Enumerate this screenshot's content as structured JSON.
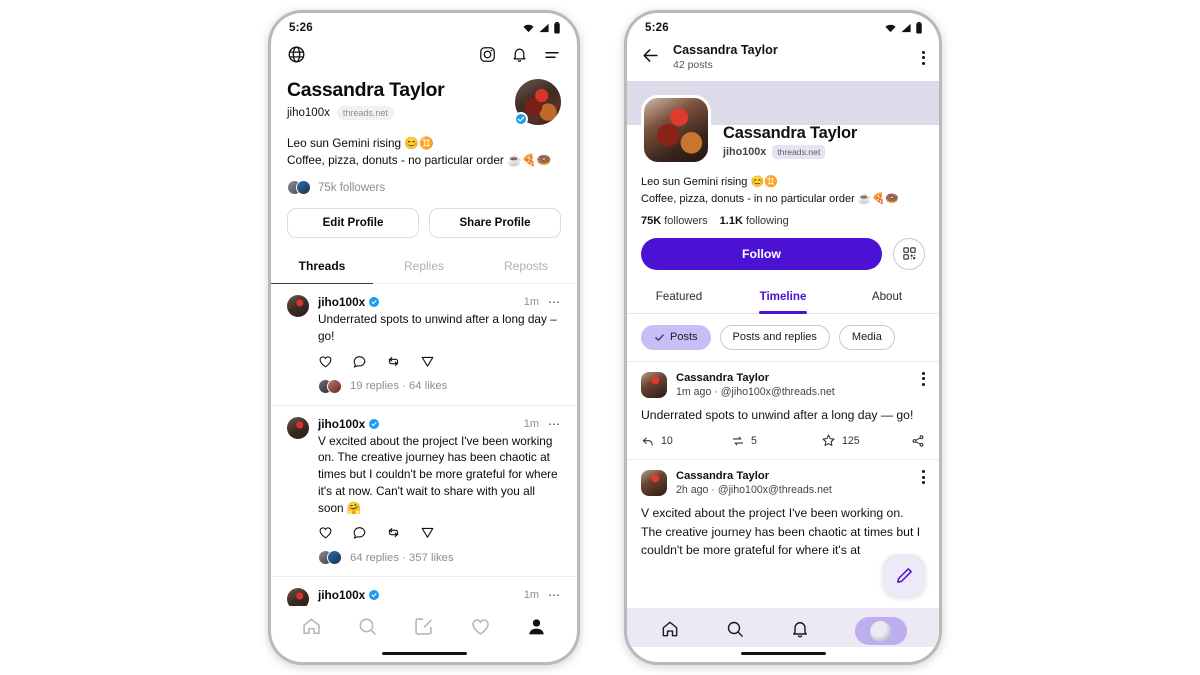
{
  "left_phone": {
    "status": {
      "time": "5:26",
      "wifi": "wifi-icon",
      "signal": "signal-icon",
      "battery": "battery-icon"
    },
    "topbar": {
      "globe": "globe-icon",
      "instagram": "instagram-icon",
      "bell": "bell-icon",
      "menu": "menu-icon"
    },
    "profile": {
      "name": "Cassandra Taylor",
      "handle": "jiho100x",
      "domain": "threads.net",
      "bio_line1": "Leo sun Gemini rising 😊♊",
      "bio_line2": "Coffee, pizza, donuts - no particular order ☕🍕🍩",
      "followers": "75k followers",
      "verified": true
    },
    "buttons": {
      "edit": "Edit Profile",
      "share": "Share Profile"
    },
    "tabs": [
      {
        "label": "Threads",
        "active": true
      },
      {
        "label": "Replies",
        "active": false
      },
      {
        "label": "Reposts",
        "active": false
      }
    ],
    "posts": [
      {
        "name": "jiho100x",
        "time": "1m",
        "text": "Underrated spots to unwind after a long day – go!",
        "stats": "19 replies · 64 likes",
        "actions": [
          "heart-icon",
          "comment-icon",
          "repost-icon",
          "send-icon"
        ]
      },
      {
        "name": "jiho100x",
        "time": "1m",
        "text": "V excited about the project I've been working on. The creative journey has been chaotic at times but I couldn't be more grateful for where it's at now. Can't wait to share with you all soon 🤗",
        "stats": "64 replies · 357 likes",
        "actions": [
          "heart-icon",
          "comment-icon",
          "repost-icon",
          "send-icon"
        ]
      },
      {
        "name": "jiho100x",
        "time": "1m",
        "text": "",
        "stats": "",
        "actions": []
      }
    ],
    "bottom_nav": [
      "home-icon",
      "search-icon",
      "compose-icon",
      "heart-icon",
      "profile-icon"
    ]
  },
  "right_phone": {
    "status": {
      "time": "5:26",
      "wifi": "wifi-icon",
      "signal": "signal-icon",
      "battery": "battery-icon"
    },
    "topbar": {
      "back": "back-arrow-icon",
      "title": "Cassandra Taylor",
      "subtitle": "42 posts",
      "kebab": "more-vertical-icon"
    },
    "profile": {
      "name": "Cassandra Taylor",
      "handle": "jiho100x",
      "domain": "threads.net",
      "bio_line1": "Leo sun Gemini rising 😊♊",
      "bio_line2": "Coffee, pizza, donuts - in no particular order ☕🍕🍩",
      "followers_count": "75K",
      "followers_label": "followers",
      "following_count": "1.1K",
      "following_label": "following"
    },
    "follow_button": "Follow",
    "qr_button": "qr-code-icon",
    "tabs": [
      {
        "label": "Featured",
        "active": false
      },
      {
        "label": "Timeline",
        "active": true
      },
      {
        "label": "About",
        "active": false
      }
    ],
    "chips": [
      {
        "label": "Posts",
        "active": true
      },
      {
        "label": "Posts and replies",
        "active": false
      },
      {
        "label": "Media",
        "active": false
      }
    ],
    "posts": [
      {
        "name": "Cassandra Taylor",
        "meta": "1m ago · @jiho100x@threads.net",
        "text": "Underrated spots to unwind after a long day — go!",
        "reply_count": "10",
        "repost_count": "5",
        "star_count": "125",
        "share": "share-icon"
      },
      {
        "name": "Cassandra Taylor",
        "meta": "2h ago · @jiho100x@threads.net",
        "text": "V excited about the project I've been working on. The creative journey has been chaotic at times but I couldn't be more grateful for where it's at",
        "reply_count": "",
        "repost_count": "",
        "star_count": "",
        "share": ""
      }
    ],
    "fab": "compose-pencil-icon",
    "bottom_nav": [
      "home-icon",
      "search-icon",
      "bell-icon",
      "profile-avatar-pill"
    ]
  },
  "colors": {
    "accent_purple": "#4b12d4",
    "chip_active": "#c9bdf5",
    "nav_bg": "#ece9f4",
    "banner": "#dcdbe9",
    "verified_blue": "#1d9bf0"
  }
}
